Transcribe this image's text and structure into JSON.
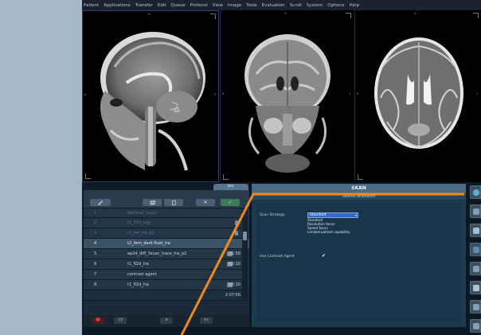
{
  "menu": [
    "Patient",
    "Applications",
    "Transfer",
    "Edit",
    "Queue",
    "Protocol",
    "View",
    "Image",
    "Tools",
    "Evaluation",
    "Scroll",
    "System",
    "Options",
    "Help"
  ],
  "viewports": [
    {
      "top": "H",
      "left": "A",
      "right": "P"
    },
    {
      "top": "H",
      "left": "R",
      "right": "L"
    },
    {
      "top": "A",
      "left": "R",
      "right": "L"
    }
  ],
  "tabs": {
    "active": "Def."
  },
  "toolbar": {
    "delete_label": "✕",
    "confirm_label": "✓"
  },
  "protocol_list": [
    {
      "num": "1",
      "name": "AAHead_Scout",
      "time": "",
      "state": "dim",
      "mark": false
    },
    {
      "num": "2",
      "name": "t1_fl2d_sag",
      "time": "",
      "state": "dim",
      "mark": true
    },
    {
      "num": "3",
      "name": "t2_tse_tra_p2",
      "time": "",
      "state": "dim",
      "mark": true
    },
    {
      "num": "4",
      "name": "t2_tirm_dark-fluid_tra",
      "time": "",
      "state": "sel",
      "mark": false
    },
    {
      "num": "5",
      "name": "ep2d_diff_3scan_trace_tra_p2",
      "time": "01:58",
      "state": "",
      "mark": true
    },
    {
      "num": "6",
      "name": "t1_fl2d_tra",
      "time": "02:10",
      "state": "",
      "mark": true
    },
    {
      "num": "7",
      "name": "contrast agent",
      "time": "",
      "state": "",
      "mark": false
    },
    {
      "num": "8",
      "name": "t1_fl2d_tra",
      "time": "02:10",
      "state": "",
      "mark": true
    }
  ],
  "total_time": "2:07:56",
  "scan": {
    "header": "SKAN",
    "section": "General Parameters",
    "strategy_label": "Scan Strategy",
    "strategy_value": "Standard",
    "strategy_options": [
      "Standard",
      "Resolution focus",
      "Speed focus",
      "Limited patient capability"
    ],
    "contrast_label": "Use Contrast Agent",
    "contrast_checked": "✔"
  },
  "colors": {
    "accent_orange": "#f08a1c",
    "selected_blue": "#2f6bd0",
    "panel": "#1d3a4d"
  }
}
